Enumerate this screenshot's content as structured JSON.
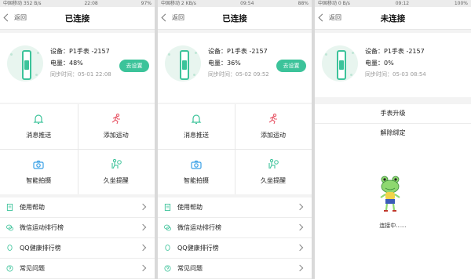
{
  "screens": [
    {
      "status": {
        "left": "中国移动 352 B/s",
        "time": "22:08",
        "right": "97%"
      },
      "back_label": "返回",
      "title": "已连接",
      "device": {
        "name": "设备：P1手表 -2157",
        "battery": "电量：48%",
        "sync": "同步时间：05-01 22:08"
      },
      "settings_button": "去设置",
      "features": [
        {
          "label": "消息推送",
          "icon": "bell-icon"
        },
        {
          "label": "添加运动",
          "icon": "running-icon"
        },
        {
          "label": "智能拍摄",
          "icon": "camera-icon"
        },
        {
          "label": "久坐提醒",
          "icon": "sitting-icon"
        }
      ],
      "list": [
        "使用帮助",
        "微信运动排行榜",
        "QQ健康排行榜",
        "常见问题"
      ]
    },
    {
      "status": {
        "left": "中国移动 2 KB/s",
        "time": "09:54",
        "right": "88%"
      },
      "back_label": "返回",
      "title": "已连接",
      "device": {
        "name": "设备：P1手表 -2157",
        "battery": "电量：36%",
        "sync": "同步时间：05-02 09:52"
      },
      "settings_button": "去设置",
      "features": [
        {
          "label": "消息推送",
          "icon": "bell-icon"
        },
        {
          "label": "添加运动",
          "icon": "running-icon"
        },
        {
          "label": "智能拍摄",
          "icon": "camera-icon"
        },
        {
          "label": "久坐提醒",
          "icon": "sitting-icon"
        }
      ],
      "list": [
        "使用帮助",
        "微信运动排行榜",
        "QQ健康排行榜",
        "常见问题"
      ]
    },
    {
      "status": {
        "left": "中国移动 0 B/s",
        "time": "09:12",
        "right": "100%"
      },
      "back_label": "返回",
      "title": "未连接",
      "device": {
        "name": "设备：P1手表 -2157",
        "battery": "电量：0%",
        "sync": "同步时间：05-03 08:54"
      },
      "menu": [
        "手表升级",
        "解除绑定"
      ],
      "connecting_text": "连接中......"
    }
  ],
  "colors": {
    "accent": "#3cc39a",
    "background": "#f3f3f3"
  }
}
